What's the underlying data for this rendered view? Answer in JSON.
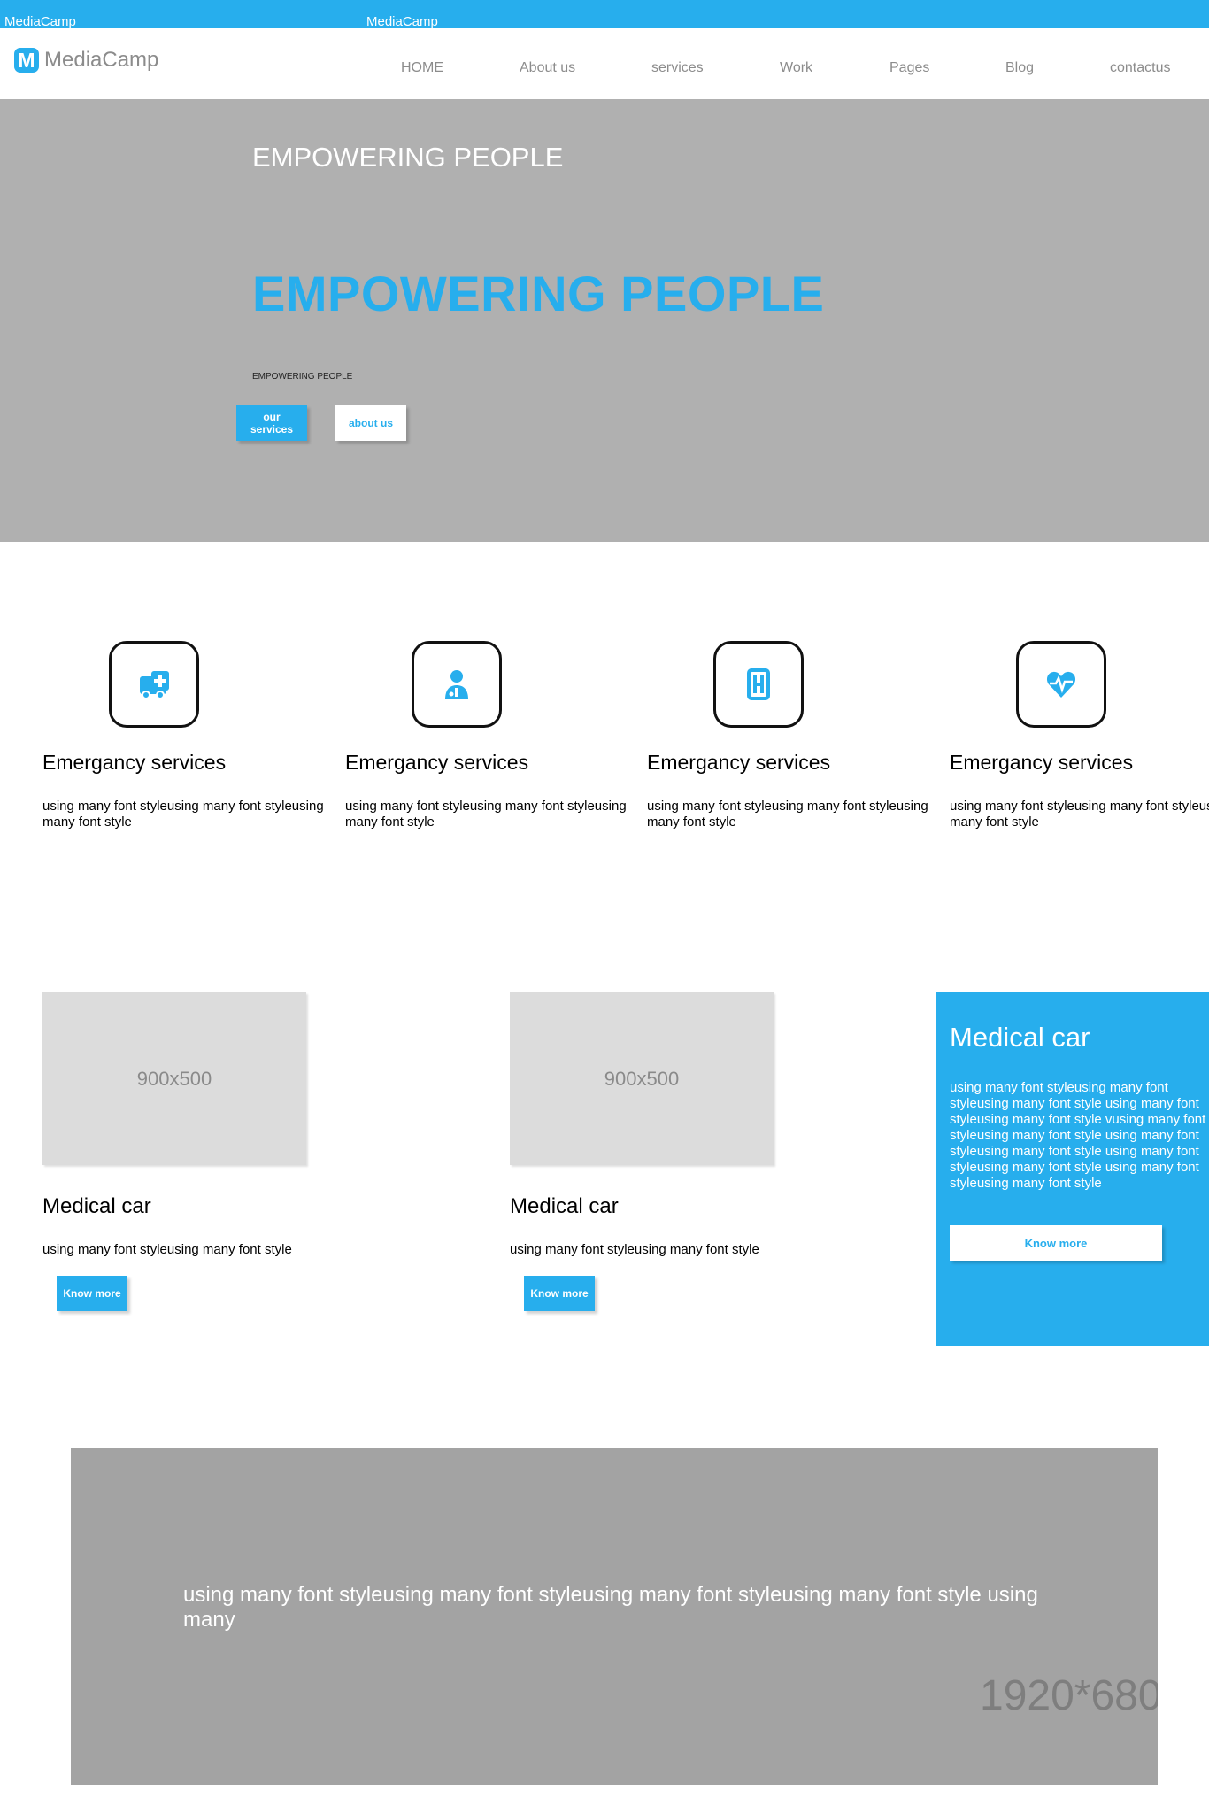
{
  "topbar": {
    "left": "MediaCamp",
    "center": "MediaCamp"
  },
  "brand": {
    "logo_letter": "M",
    "name": "MediaCamp"
  },
  "nav": [
    "HOME",
    "About us",
    "services",
    "Work",
    "Pages",
    "Blog",
    "contactus"
  ],
  "hero": {
    "subtitle": "EMPOWERING PEOPLE",
    "title": "EMPOWERING PEOPLE",
    "tagline": "EMPOWERING PEOPLE",
    "btn_services": "our services",
    "btn_about": "about us"
  },
  "services": [
    {
      "icon": "ambulance-icon",
      "title": "Emergancy services",
      "text": "using many font styleusing many font styleusing many font style"
    },
    {
      "icon": "doctor-icon",
      "title": "Emergancy services",
      "text": "using many font styleusing many font styleusing many font style"
    },
    {
      "icon": "hospital-icon",
      "title": "Emergancy services",
      "text": "using many font styleusing many font styleusing many font style"
    },
    {
      "icon": "heartbeat-icon",
      "title": "Emergancy services",
      "text": "using many font styleusing many font styleusing many font style"
    }
  ],
  "cards": [
    {
      "image_label": "900x500",
      "title": "Medical car",
      "text": "using many font styleusing many font style",
      "button": "Know more"
    },
    {
      "image_label": "900x500",
      "title": "Medical car",
      "text": "using many font styleusing many font style",
      "button": "Know more"
    }
  ],
  "featured": {
    "title": "Medical car",
    "text": "using many font styleusing many font styleusing many font style using many font styleusing many font style vusing many font styleusing many font style using many font styleusing many font style using many font styleusing many font style using many font styleusing many font style",
    "button": "Know more"
  },
  "banner": {
    "text": "using many font styleusing many font styleusing many font styleusing many font style using many",
    "image_label": "1920*680"
  },
  "colors": {
    "accent": "#27aeed",
    "hero_bg": "#b0b0b0",
    "banner_bg": "#a3a3a3",
    "placeholder_bg": "#dcdcdc"
  }
}
